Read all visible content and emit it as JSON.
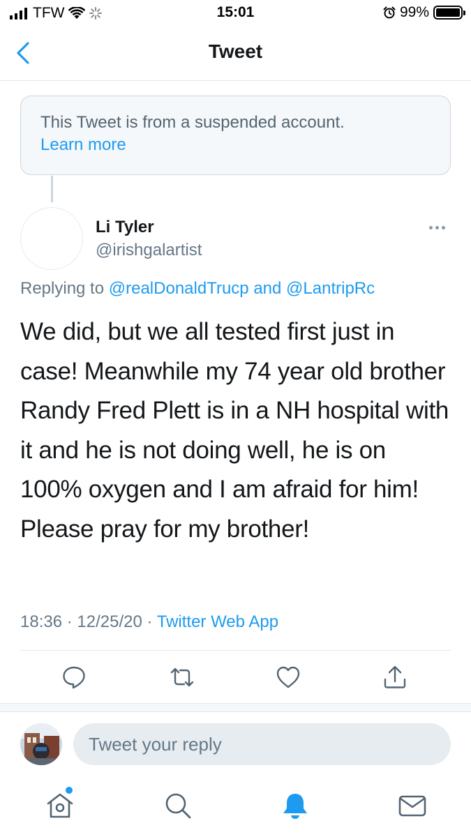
{
  "status_bar": {
    "carrier": "TFW",
    "time": "15:01",
    "battery": "99%"
  },
  "nav": {
    "title": "Tweet"
  },
  "notice": {
    "text": "This Tweet is from a suspended account.",
    "link": "Learn more"
  },
  "tweet": {
    "author_name": "Li Tyler",
    "author_handle": "@irishgalartist",
    "replying_prefix": "Replying to",
    "reply_mention_1": "@realDonaldTrucp",
    "reply_conjunction": "and",
    "reply_mention_2": "@LantripRc",
    "text": "We did, but we all tested first just in case! Meanwhile my 74 year old brother Randy Fred Plett is in a NH hospital with it and he is not doing well, he is on 100% oxygen and I am afraid for him! Please pray for my brother!",
    "time": "18:36",
    "date": "12/25/20",
    "source": "Twitter Web App",
    "separator": "·"
  },
  "actions": [
    "reply-icon",
    "retweet-icon",
    "like-icon",
    "share-icon"
  ],
  "reply_bar": {
    "placeholder": "Tweet your reply"
  },
  "tabs": [
    "home-icon",
    "search-icon",
    "notifications-icon",
    "messages-icon"
  ],
  "colors": {
    "accent": "#1d9bf0",
    "text_primary": "#14171a",
    "text_secondary": "#657786"
  }
}
